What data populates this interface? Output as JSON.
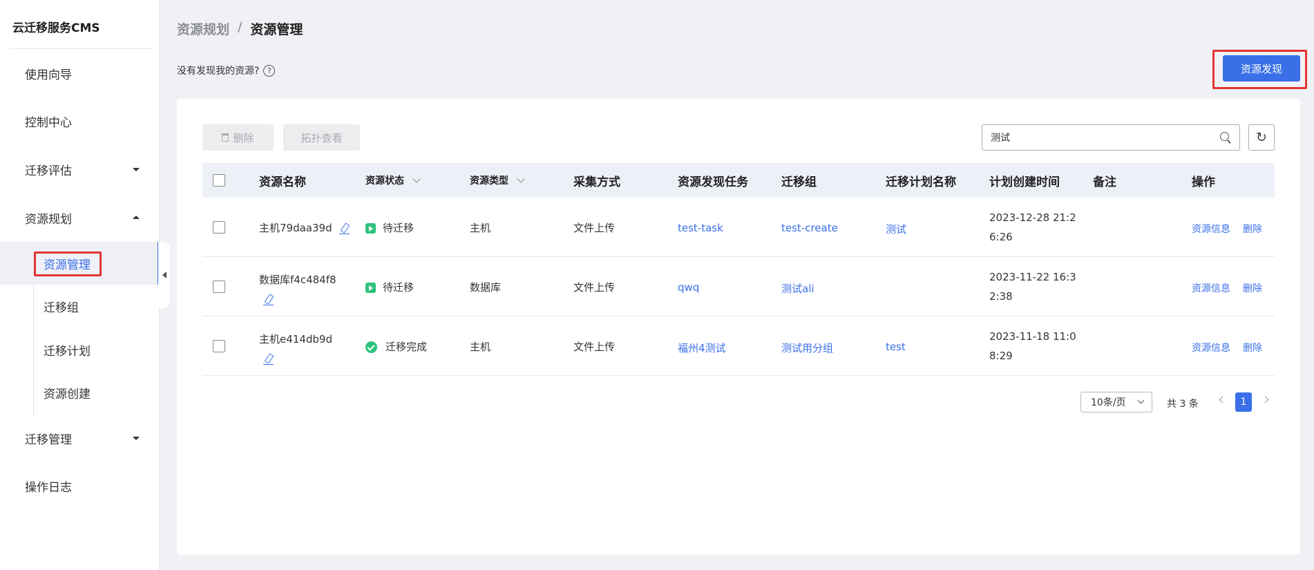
{
  "app": {
    "brand": "云迁移服务CMS"
  },
  "sidebar": {
    "items": [
      {
        "label": "使用向导"
      },
      {
        "label": "控制中心"
      },
      {
        "label": "迁移评估"
      },
      {
        "label": "资源规划"
      },
      {
        "label": "迁移管理"
      },
      {
        "label": "操作日志"
      }
    ],
    "sub_items": [
      {
        "label": "资源管理"
      },
      {
        "label": "迁移组"
      },
      {
        "label": "迁移计划"
      },
      {
        "label": "资源创建"
      }
    ]
  },
  "header": {
    "breadcrumb_parent": "资源规划",
    "breadcrumb_sep": "/",
    "breadcrumb_current": "资源管理",
    "hint": "没有发现我的资源?",
    "help_glyph": "?",
    "discover_label": "资源发现"
  },
  "toolbar": {
    "delete_label": "删除",
    "topology_label": "拓扑查看",
    "search_value": "测试",
    "refresh_glyph": "↻"
  },
  "table": {
    "columns": [
      {
        "label": "资源名称"
      },
      {
        "label": "资源状态"
      },
      {
        "label": "资源类型"
      },
      {
        "label": "采集方式"
      },
      {
        "label": "资源发现任务"
      },
      {
        "label": "迁移组"
      },
      {
        "label": "迁移计划名称"
      },
      {
        "label": "计划创建时间"
      },
      {
        "label": "备注"
      },
      {
        "label": "操作"
      }
    ],
    "rows": [
      {
        "name": "主机79daa39d",
        "status": "待迁移",
        "status_kind": "pending",
        "type": "主机",
        "collect": "文件上传",
        "task": "test-task",
        "group": "test-create",
        "plan": "测试",
        "time_line1": "2023-12-28 21:2",
        "time_line2": "6:26",
        "remark": "",
        "op_info": "资源信息",
        "op_delete": "删除"
      },
      {
        "name": "数据库f4c484f8",
        "status": "待迁移",
        "status_kind": "pending",
        "type": "数据库",
        "collect": "文件上传",
        "task": "qwq",
        "group": "测试ali",
        "plan": "",
        "time_line1": "2023-11-22 16:3",
        "time_line2": "2:38",
        "remark": "",
        "op_info": "资源信息",
        "op_delete": "删除"
      },
      {
        "name": "主机e414db9d",
        "status": "迁移完成",
        "status_kind": "done",
        "type": "主机",
        "collect": "文件上传",
        "task": "福州4测试",
        "group": "测试用分组",
        "plan": "test",
        "time_line1": "2023-11-18 11:0",
        "time_line2": "8:29",
        "remark": "",
        "op_info": "资源信息",
        "op_delete": "删除"
      }
    ]
  },
  "pagination": {
    "page_size": "10条/页",
    "total": "共 3 条",
    "current_page": "1"
  },
  "colors": {
    "accent": "#3a6fe8",
    "success": "#2ec27e",
    "highlight_box": "#e43232"
  }
}
